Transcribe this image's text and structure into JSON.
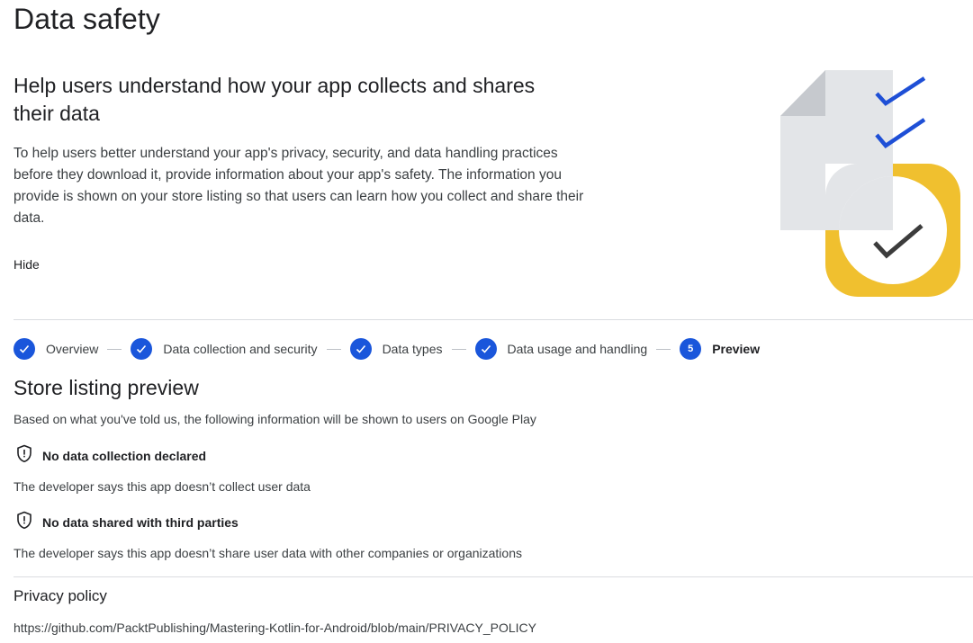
{
  "page": {
    "title": "Data safety"
  },
  "intro": {
    "heading": "Help users understand how your app collects and shares their data",
    "body": "To help users better understand your app's privacy, security, and data handling practices before they download it, provide information about your app's safety. The information you provide is shown on your store listing so that users can learn how you collect and share their data.",
    "hide_label": "Hide"
  },
  "illustration": {
    "icon": "document-checklist-illustration",
    "colors": {
      "document": "#e3e5e8",
      "document_fold": "#c6c9ce",
      "checks": "#1e4fd6",
      "badge": "#f0c02f",
      "badge_check": "#3c3c3c"
    }
  },
  "stepper": {
    "accent_color": "#1a56db",
    "steps": [
      {
        "label": "Overview",
        "state": "complete",
        "icon": "check-icon"
      },
      {
        "label": "Data collection and security",
        "state": "complete",
        "icon": "check-icon"
      },
      {
        "label": "Data types",
        "state": "complete",
        "icon": "check-icon"
      },
      {
        "label": "Data usage and handling",
        "state": "complete",
        "icon": "check-icon"
      },
      {
        "label": "Preview",
        "state": "current",
        "number": "5"
      }
    ]
  },
  "preview": {
    "title": "Store listing preview",
    "subtitle": "Based on what you've told us, the following information will be shown to users on Google Play",
    "items": [
      {
        "icon": "shield-alert-icon",
        "title": "No data collection declared",
        "description": "The developer says this app doesn’t collect user data"
      },
      {
        "icon": "shield-alert-icon",
        "title": "No data shared with third parties",
        "description": "The developer says this app doesn’t share user data with other companies or organizations"
      }
    ]
  },
  "privacy_policy": {
    "title": "Privacy policy",
    "url": "https://github.com/PacktPublishing/Mastering-Kotlin-for-Android/blob/main/PRIVACY_POLICY"
  }
}
